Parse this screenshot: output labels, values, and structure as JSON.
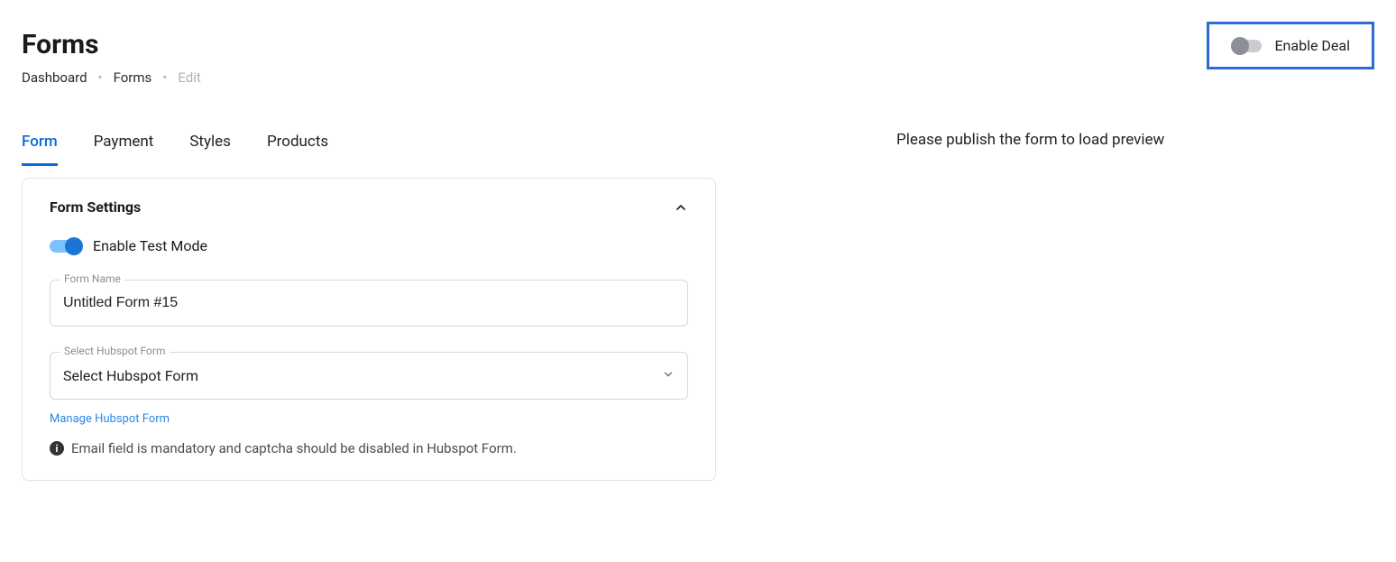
{
  "header": {
    "title": "Forms",
    "breadcrumb": {
      "dashboard": "Dashboard",
      "forms": "Forms",
      "edit": "Edit",
      "sep": "•"
    },
    "enable_deal": {
      "label": "Enable Deal",
      "on": false
    }
  },
  "tabs": {
    "form": "Form",
    "payment": "Payment",
    "styles": "Styles",
    "products": "Products",
    "active": "form"
  },
  "settings": {
    "card_title": "Form Settings",
    "test_mode": {
      "label": "Enable Test Mode",
      "on": true
    },
    "form_name": {
      "label": "Form Name",
      "value": "Untitled Form #15"
    },
    "hubspot_select": {
      "label": "Select Hubspot Form",
      "placeholder": "Select Hubspot Form"
    },
    "manage_link": "Manage Hubspot Form",
    "note": "Email field is mandatory and captcha should be disabled in Hubspot Form."
  },
  "preview": {
    "message": "Please publish the form to load preview"
  }
}
